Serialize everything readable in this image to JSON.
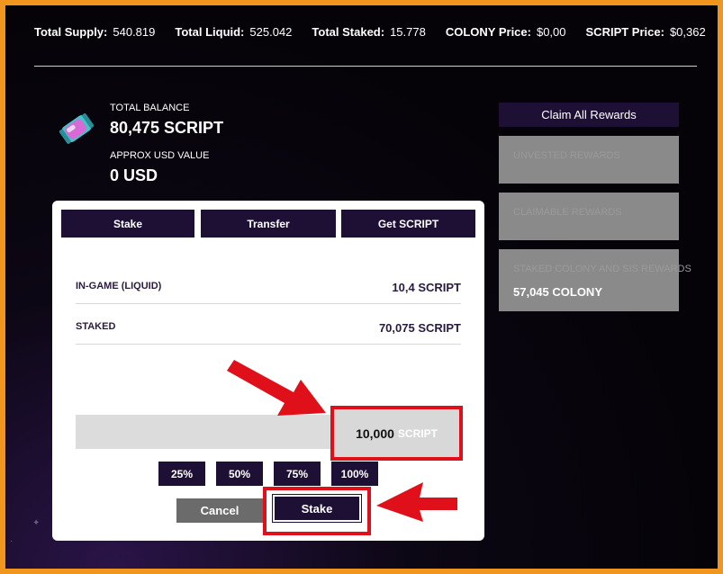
{
  "stats": [
    {
      "label": "Total Supply:",
      "value": "540.819"
    },
    {
      "label": "Total Liquid:",
      "value": "525.042"
    },
    {
      "label": "Total Staked:",
      "value": "15.778"
    },
    {
      "label": "COLONY Price:",
      "value": "$0,00"
    },
    {
      "label": "SCRIPT Price:",
      "value": "$0,362"
    }
  ],
  "balance": {
    "total_label": "TOTAL BALANCE",
    "total_value": "80,475 SCRIPT",
    "usd_label": "APPROX USD VALUE",
    "usd_value": "0 USD"
  },
  "tabs": [
    "Stake",
    "Transfer",
    "Get SCRIPT"
  ],
  "rows": [
    {
      "label": "IN-GAME (LIQUID)",
      "value": "10,4 SCRIPT"
    },
    {
      "label": "STAKED",
      "value": "70,075 SCRIPT"
    }
  ],
  "amount": {
    "value": "10,000",
    "unit": "SCRIPT"
  },
  "percent_buttons": [
    "25%",
    "50%",
    "75%",
    "100%"
  ],
  "actions": {
    "cancel": "Cancel",
    "stake": "Stake"
  },
  "rewards": {
    "claim_all": "Claim All Rewards",
    "cards": [
      {
        "label": "UNVESTED REWARDS",
        "value": ""
      },
      {
        "label": "CLAIMABLE REWARDS",
        "value": ""
      },
      {
        "label": "STAKED COLONY AND SIS REWARDS",
        "value": "57,045 COLONY"
      }
    ]
  },
  "colors": {
    "accent": "#1e1035",
    "highlight": "#e0101a",
    "frame": "#f0961e"
  }
}
